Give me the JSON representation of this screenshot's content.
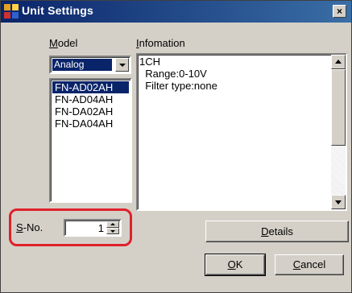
{
  "window": {
    "title": "Unit Settings",
    "close_glyph": "×"
  },
  "model": {
    "label": "Model",
    "label_mnemonic": "M",
    "label_rest": "odel",
    "selected": "Analog",
    "items": [
      "FN-AD02AH",
      "FN-AD04AH",
      "FN-DA02AH",
      "FN-DA04AH"
    ],
    "selected_index": 0
  },
  "information": {
    "label_mnemonic": "I",
    "label_rest": "nfomation",
    "text": "1CH\n  Range:0-10V\n  Filter type:none"
  },
  "sno": {
    "label_mnemonic": "S",
    "label_rest": "-No.",
    "value": "1"
  },
  "buttons": {
    "details_mnemonic": "D",
    "details_rest": "etails",
    "ok_mnemonic": "O",
    "ok_rest": "K",
    "cancel_mnemonic": "C",
    "cancel_rest": "ancel"
  },
  "colors": {
    "highlight": "#e0202a",
    "titlebar": "#0a246a",
    "selection": "#0a246a"
  }
}
